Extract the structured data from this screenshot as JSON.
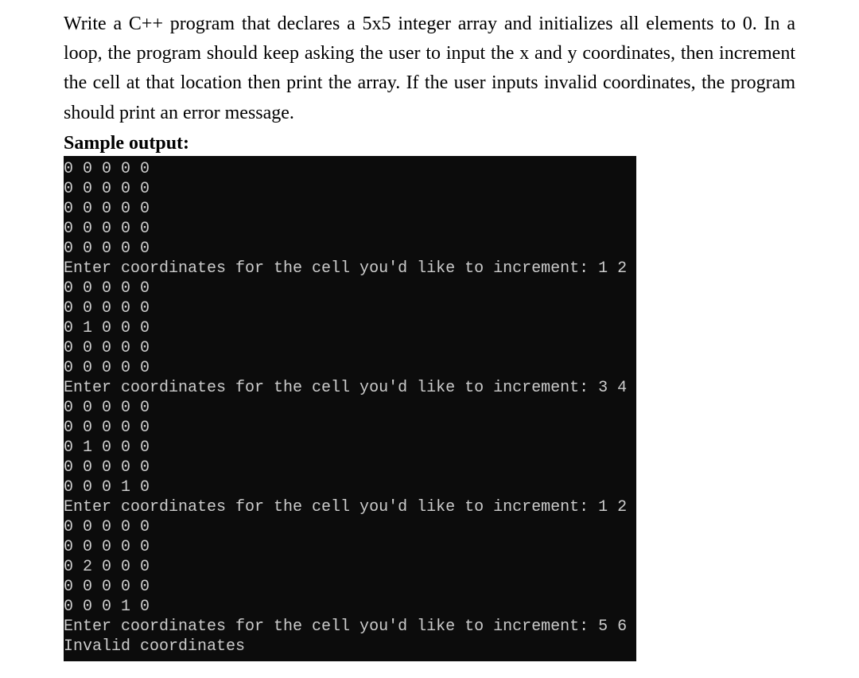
{
  "question": "Write a C++ program that declares a 5x5 integer array and initializes all elements to 0. In a loop, the program should keep asking the user to input the x and y coordinates, then increment the cell at that location then print the array. If the user inputs invalid coordinates, the program should print an error message.",
  "sample_label": "Sample output:",
  "terminal_lines": [
    "0 0 0 0 0",
    "0 0 0 0 0",
    "0 0 0 0 0",
    "0 0 0 0 0",
    "0 0 0 0 0",
    "Enter coordinates for the cell you'd like to increment: 1 2",
    "0 0 0 0 0",
    "0 0 0 0 0",
    "0 1 0 0 0",
    "0 0 0 0 0",
    "0 0 0 0 0",
    "Enter coordinates for the cell you'd like to increment: 3 4",
    "0 0 0 0 0",
    "0 0 0 0 0",
    "0 1 0 0 0",
    "0 0 0 0 0",
    "0 0 0 1 0",
    "Enter coordinates for the cell you'd like to increment: 1 2",
    "0 0 0 0 0",
    "0 0 0 0 0",
    "0 2 0 0 0",
    "0 0 0 0 0",
    "0 0 0 1 0",
    "Enter coordinates for the cell you'd like to increment: 5 6",
    "Invalid coordinates"
  ]
}
